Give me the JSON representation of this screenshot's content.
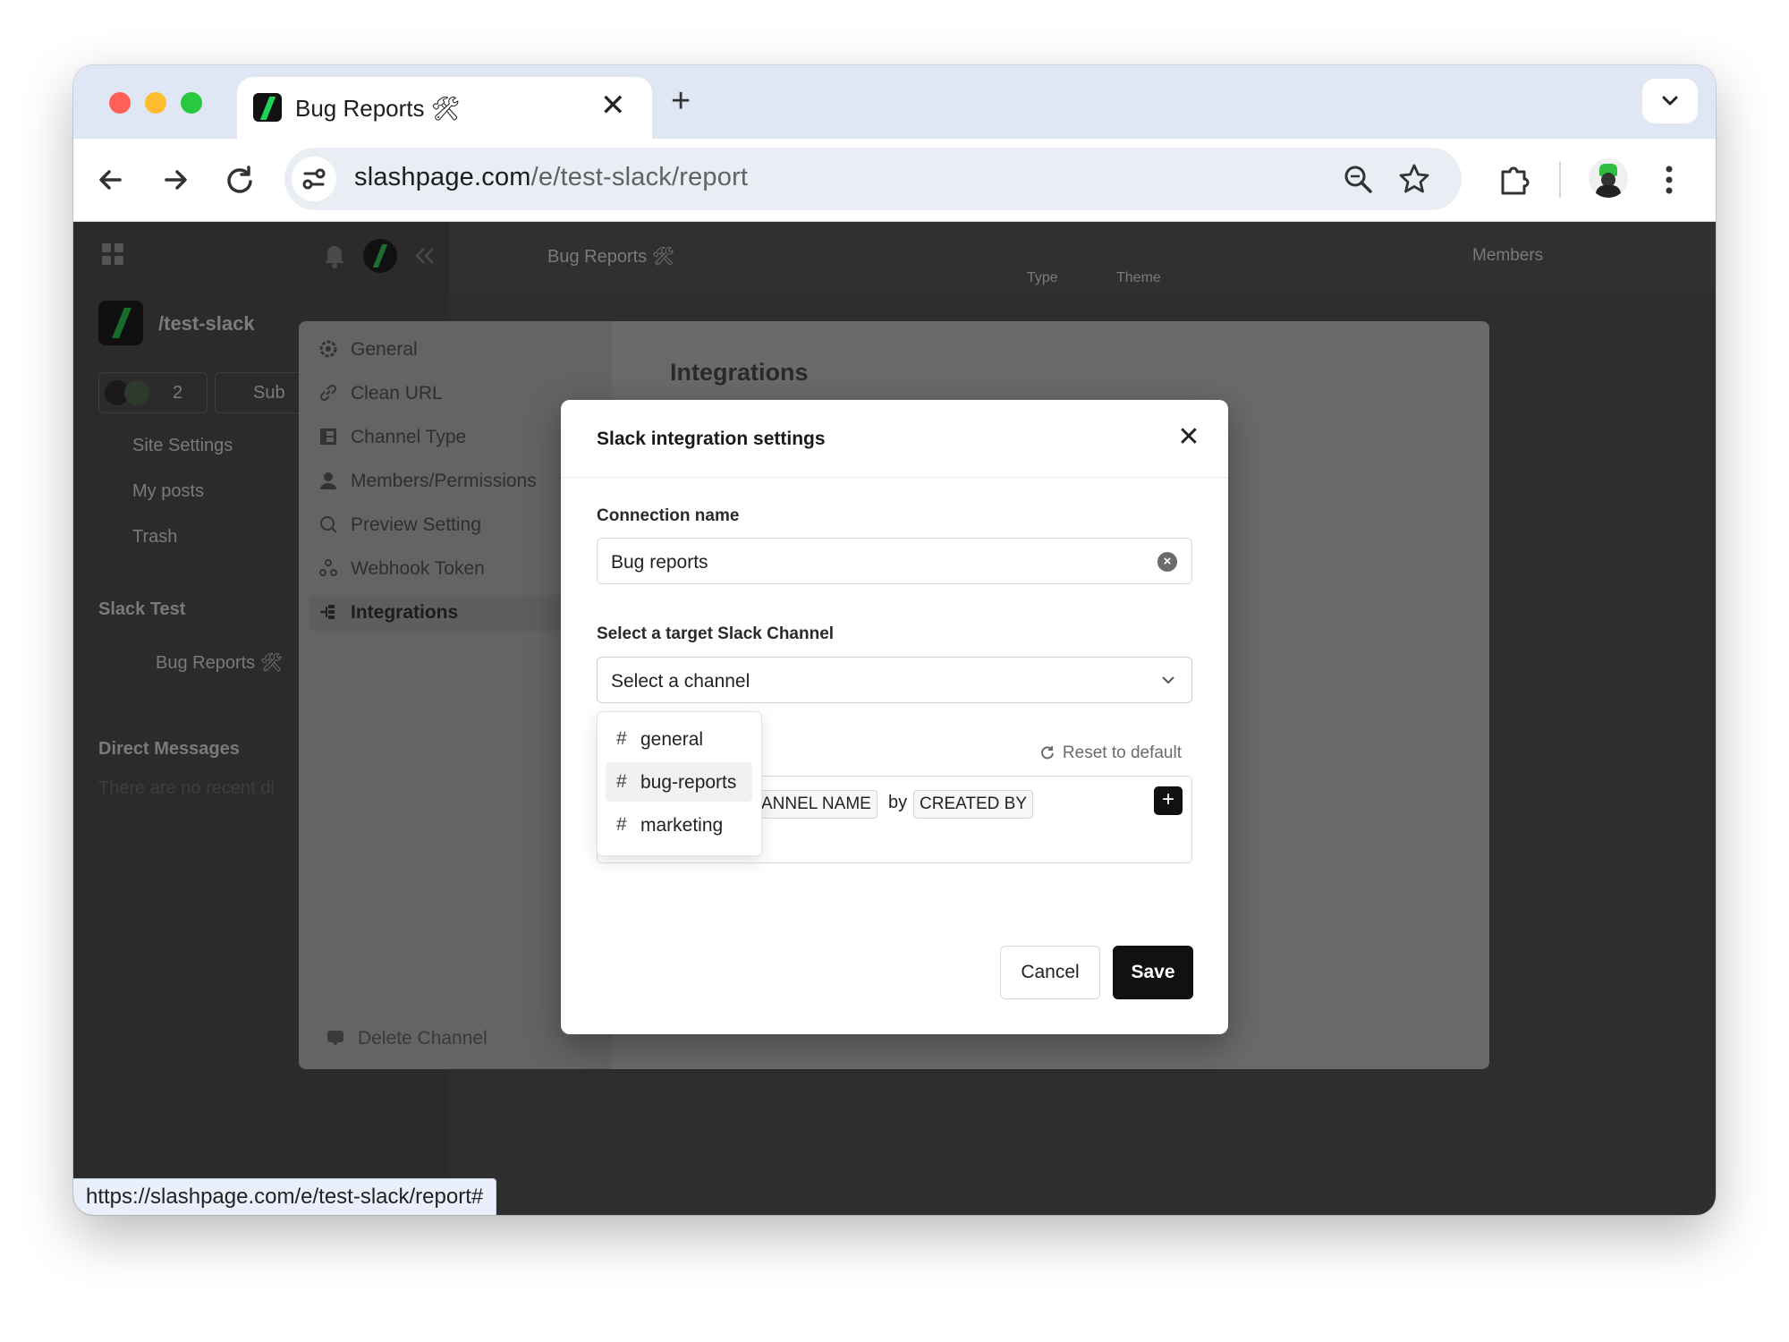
{
  "browser": {
    "tab_title": "Bug Reports 🛠",
    "url_host": "slashpage.com",
    "url_path": "/e/test-slack/report",
    "status_url": "https://slashpage.com/e/test-slack/report#"
  },
  "app": {
    "breadcrumb_channel": "Bug Reports 🛠",
    "toolbar_type": "Type",
    "toolbar_theme": "Theme",
    "members_label": "Members",
    "workspace_name": "/test-slack",
    "member_count": "2",
    "subscribe_label": "Sub",
    "nav": [
      "Site Settings",
      "My posts",
      "Trash"
    ],
    "section_slack": "Slack Test",
    "channel_item": "Bug Reports 🛠",
    "section_dm": "Direct Messages",
    "dm_empty": "There are no recent di",
    "content_heading": "Integrations"
  },
  "settings_menu": {
    "items": [
      "General",
      "Clean URL",
      "Channel Type",
      "Members/Permissions",
      "Preview Setting",
      "Webhook Token",
      "Integrations"
    ],
    "active": "Integrations",
    "delete_label": "Delete Channel"
  },
  "dialog": {
    "title": "Slack integration settings",
    "connection_label": "Connection name",
    "connection_value": "Bug reports",
    "channel_label": "Select a target Slack Channel",
    "channel_placeholder": "Select a channel",
    "reset_label": "Reset to default",
    "chip_channel": "ANNEL NAME",
    "by_word": "by",
    "chip_created": "CREATED BY",
    "cancel_label": "Cancel",
    "save_label": "Save",
    "channel_options": [
      {
        "hash": "#",
        "name": "general"
      },
      {
        "hash": "#",
        "name": "bug-reports"
      },
      {
        "hash": "#",
        "name": "marketing"
      }
    ]
  },
  "colors": {
    "accent_green": "#22e23a",
    "primary_button": "#111111"
  }
}
